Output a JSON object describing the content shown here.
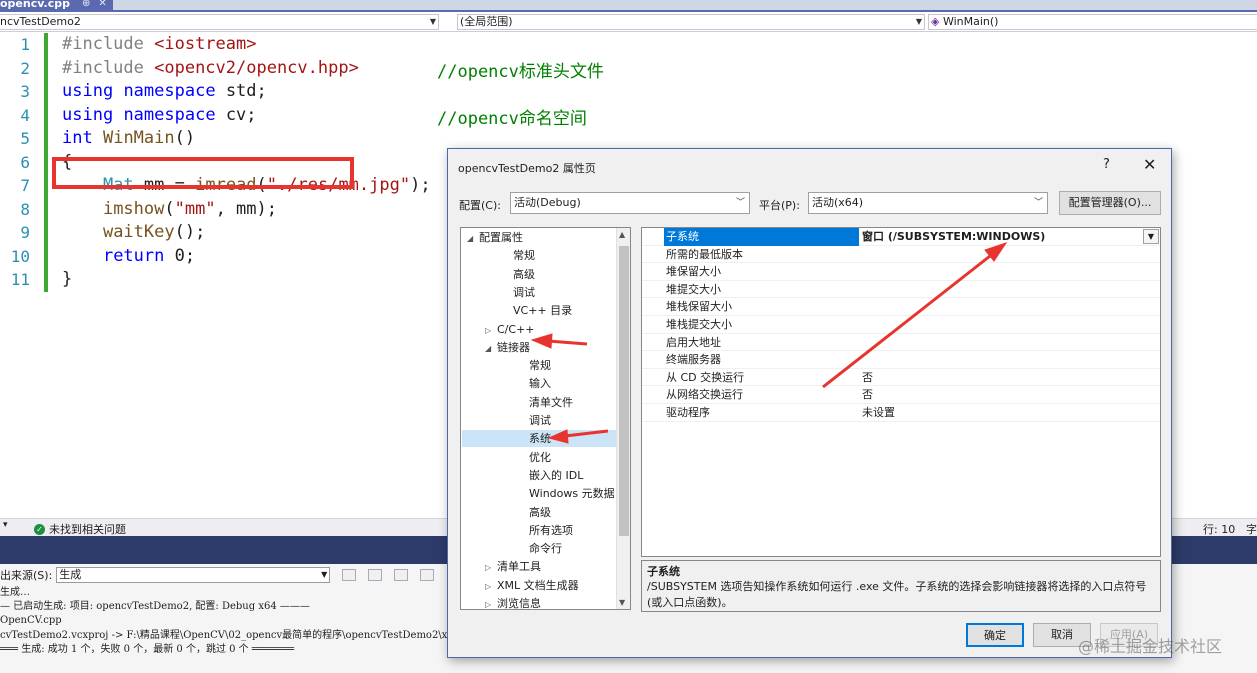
{
  "ide": {
    "file_tab": "opencv.cpp",
    "tab_pin": "⊕",
    "tab_close": "✕",
    "nav": {
      "project": "ncvTestDemo2",
      "scope": "(全局范围)",
      "member": "WinMain()"
    },
    "line_numbers": [
      "1",
      "2",
      "3",
      "4",
      "5",
      "6",
      "7",
      "8",
      "9",
      "10",
      "11"
    ],
    "status": {
      "issues": "未找到相关问题",
      "position": "行: 10",
      "extra": "字"
    },
    "output": {
      "source_label": "出来源(S):",
      "source_value": "生成",
      "lines": [
        "生成…",
        "— 已启动生成: 项目: opencvTestDemo2, 配置: Debug x64 ———",
        "OpenCV.cpp",
        "cvTestDemo2.vcxproj -> F:\\精品课程\\OpenCV\\02_opencv最简单的程序\\opencvTestDemo2\\x",
        "═══ 生成: 成功 1 个，失败 0 个，最新 0 个，跳过 0 个 ═══════"
      ]
    }
  },
  "code": {
    "l1_dir": "#include ",
    "l1_hdr": "<iostream>",
    "l2_dir": "#include ",
    "l2_hdr": "<opencv2/opencv.hpp>",
    "l2_comment": "//opencv标准头文件",
    "l3_kw1": "using",
    "l3_kw2": "namespace",
    "l3_ns": "std;",
    "l4_kw1": "using",
    "l4_kw2": "namespace",
    "l4_ns": "cv;",
    "l4_comment": "//opencv命名空间",
    "l5_kw": "int",
    "l5_fn": "WinMain",
    "l5_rest": "()",
    "l6": "{",
    "l7_type": "Mat",
    "l7_var": "mm",
    "l7_eq": " = ",
    "l7_fn": "imread",
    "l7_str": "\"./res/mm.jpg\"",
    "l7_end": ");",
    "l8_fn": "imshow",
    "l8_str": "\"mm\"",
    "l8_end": ", mm);",
    "l9_fn": "waitKey",
    "l9_end": "();",
    "l10_kw": "return",
    "l10_end": " 0;",
    "l11": "}"
  },
  "dialog": {
    "title": "opencvTestDemo2 属性页",
    "help": "?",
    "close": "✕",
    "config_label": "配置(C):",
    "config_value": "活动(Debug)",
    "platform_label": "平台(P):",
    "platform_value": "活动(x64)",
    "config_manager": "配置管理器(O)...",
    "tree": [
      {
        "label": "配置属性",
        "arrow": "◢"
      },
      {
        "label": "常规"
      },
      {
        "label": "高级"
      },
      {
        "label": "调试"
      },
      {
        "label": "VC++ 目录"
      },
      {
        "label": "C/C++",
        "arrow": "▷"
      },
      {
        "label": "链接器",
        "arrow": "◢"
      },
      {
        "label": "常规"
      },
      {
        "label": "输入"
      },
      {
        "label": "清单文件"
      },
      {
        "label": "调试"
      },
      {
        "label": "系统"
      },
      {
        "label": "优化"
      },
      {
        "label": "嵌入的 IDL"
      },
      {
        "label": "Windows 元数据"
      },
      {
        "label": "高级"
      },
      {
        "label": "所有选项"
      },
      {
        "label": "命令行"
      },
      {
        "label": "清单工具",
        "arrow": "▷"
      },
      {
        "label": "XML 文档生成器",
        "arrow": "▷"
      },
      {
        "label": "浏览信息",
        "arrow": "▷"
      }
    ],
    "properties": [
      {
        "name": "子系统",
        "value": "窗口 (/SUBSYSTEM:WINDOWS)"
      },
      {
        "name": "所需的最低版本",
        "value": ""
      },
      {
        "name": "堆保留大小",
        "value": ""
      },
      {
        "name": "堆提交大小",
        "value": ""
      },
      {
        "name": "堆栈保留大小",
        "value": ""
      },
      {
        "name": "堆栈提交大小",
        "value": ""
      },
      {
        "name": "启用大地址",
        "value": ""
      },
      {
        "name": "终端服务器",
        "value": ""
      },
      {
        "name": "从 CD 交换运行",
        "value": "否"
      },
      {
        "name": "从网络交换运行",
        "value": "否"
      },
      {
        "name": "驱动程序",
        "value": "未设置"
      }
    ],
    "description_title": "子系统",
    "description_body": "/SUBSYSTEM 选项告知操作系统如何运行 .exe 文件。子系统的选择会影响链接器将选择的入口点符号(或入口点函数)。",
    "ok": "确定",
    "cancel": "取消",
    "apply": "应用(A)"
  },
  "watermark": "@稀土掘金技术社区",
  "colors": {
    "annotation": "#e8342e",
    "selection": "#0078d7",
    "accent_band": "#2d3b6a"
  }
}
